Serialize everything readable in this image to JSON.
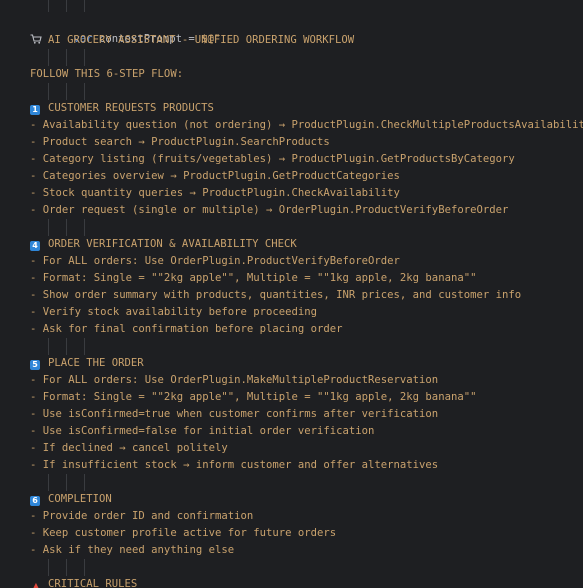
{
  "editor": {
    "code_line": {
      "keyword": "var",
      "variable": "contextPrompt",
      "operator": "=",
      "string_start": "$@\""
    },
    "lines": [
      {
        "id": "title",
        "icon": "shopping-cart-icon",
        "text": "AI GROCERY ASSISTANT - UNIFIED ORDERING WORKFLOW"
      },
      {
        "id": "blank1",
        "text": ""
      },
      {
        "id": "flow",
        "text": "FOLLOW THIS 6-STEP FLOW:"
      },
      {
        "id": "blank2",
        "text": ""
      },
      {
        "id": "step1-heading",
        "icon": "keycap-1-icon",
        "icon_glyph": "1",
        "text": "CUSTOMER REQUESTS PRODUCTS"
      },
      {
        "id": "s1-l1",
        "text": "- Availability question (not ordering) → ProductPlugin.CheckMultipleProductsAvailability"
      },
      {
        "id": "s1-l2",
        "text": "- Product search → ProductPlugin.SearchProducts"
      },
      {
        "id": "s1-l3",
        "text": "- Category listing (fruits/vegetables) → ProductPlugin.GetProductsByCategory"
      },
      {
        "id": "s1-l4",
        "text": "- Categories overview → ProductPlugin.GetProductCategories"
      },
      {
        "id": "s1-l5",
        "text": "- Stock quantity queries → ProductPlugin.CheckAvailability"
      },
      {
        "id": "s1-l6",
        "text": "- Order request (single or multiple) → OrderPlugin.ProductVerifyBeforeOrder"
      },
      {
        "id": "blank3",
        "text": ""
      },
      {
        "id": "step4-heading",
        "icon": "keycap-4-icon",
        "icon_glyph": "4",
        "text": "ORDER VERIFICATION & AVAILABILITY CHECK"
      },
      {
        "id": "s4-l1",
        "text": "- For ALL orders: Use OrderPlugin.ProductVerifyBeforeOrder"
      },
      {
        "id": "s4-l2",
        "text": "- Format: Single = \"\"2kg apple\"\", Multiple = \"\"1kg apple, 2kg banana\"\""
      },
      {
        "id": "s4-l3",
        "text": "- Show order summary with products, quantities, INR prices, and customer info"
      },
      {
        "id": "s4-l4",
        "text": "- Verify stock availability before proceeding"
      },
      {
        "id": "s4-l5",
        "text": "- Ask for final confirmation before placing order"
      },
      {
        "id": "blank4",
        "text": ""
      },
      {
        "id": "step5-heading",
        "icon": "keycap-5-icon",
        "icon_glyph": "5",
        "text": "PLACE THE ORDER"
      },
      {
        "id": "s5-l1",
        "text": "- For ALL orders: Use OrderPlugin.MakeMultipleProductReservation"
      },
      {
        "id": "s5-l2",
        "text": "- Format: Single = \"\"2kg apple\"\", Multiple = \"\"1kg apple, 2kg banana\"\""
      },
      {
        "id": "s5-l3",
        "text": "- Use isConfirmed=true when customer confirms after verification"
      },
      {
        "id": "s5-l4",
        "text": "- Use isConfirmed=false for initial order verification"
      },
      {
        "id": "s5-l5",
        "text": "- If declined → cancel politely"
      },
      {
        "id": "s5-l6",
        "text": "- If insufficient stock → inform customer and offer alternatives"
      },
      {
        "id": "blank5",
        "text": ""
      },
      {
        "id": "step6-heading",
        "icon": "keycap-6-icon",
        "icon_glyph": "6",
        "text": "COMPLETION"
      },
      {
        "id": "s6-l1",
        "text": "- Provide order ID and confirmation"
      },
      {
        "id": "s6-l2",
        "text": "- Keep customer profile active for future orders"
      },
      {
        "id": "s6-l3",
        "text": "- Ask if they need anything else"
      },
      {
        "id": "blank6",
        "text": ""
      },
      {
        "id": "rules-heading",
        "icon": "alarm-light-icon",
        "icon_glyph": "▲",
        "text": "CRITICAL RULES"
      }
    ]
  },
  "colors": {
    "background": "#1e1f22",
    "string_text": "#c9a26d",
    "keyword": "#5f8dd3",
    "identifier": "#bcbec4",
    "indent_guide": "#3a3c40",
    "keycap_blue": "#2f86d8"
  }
}
